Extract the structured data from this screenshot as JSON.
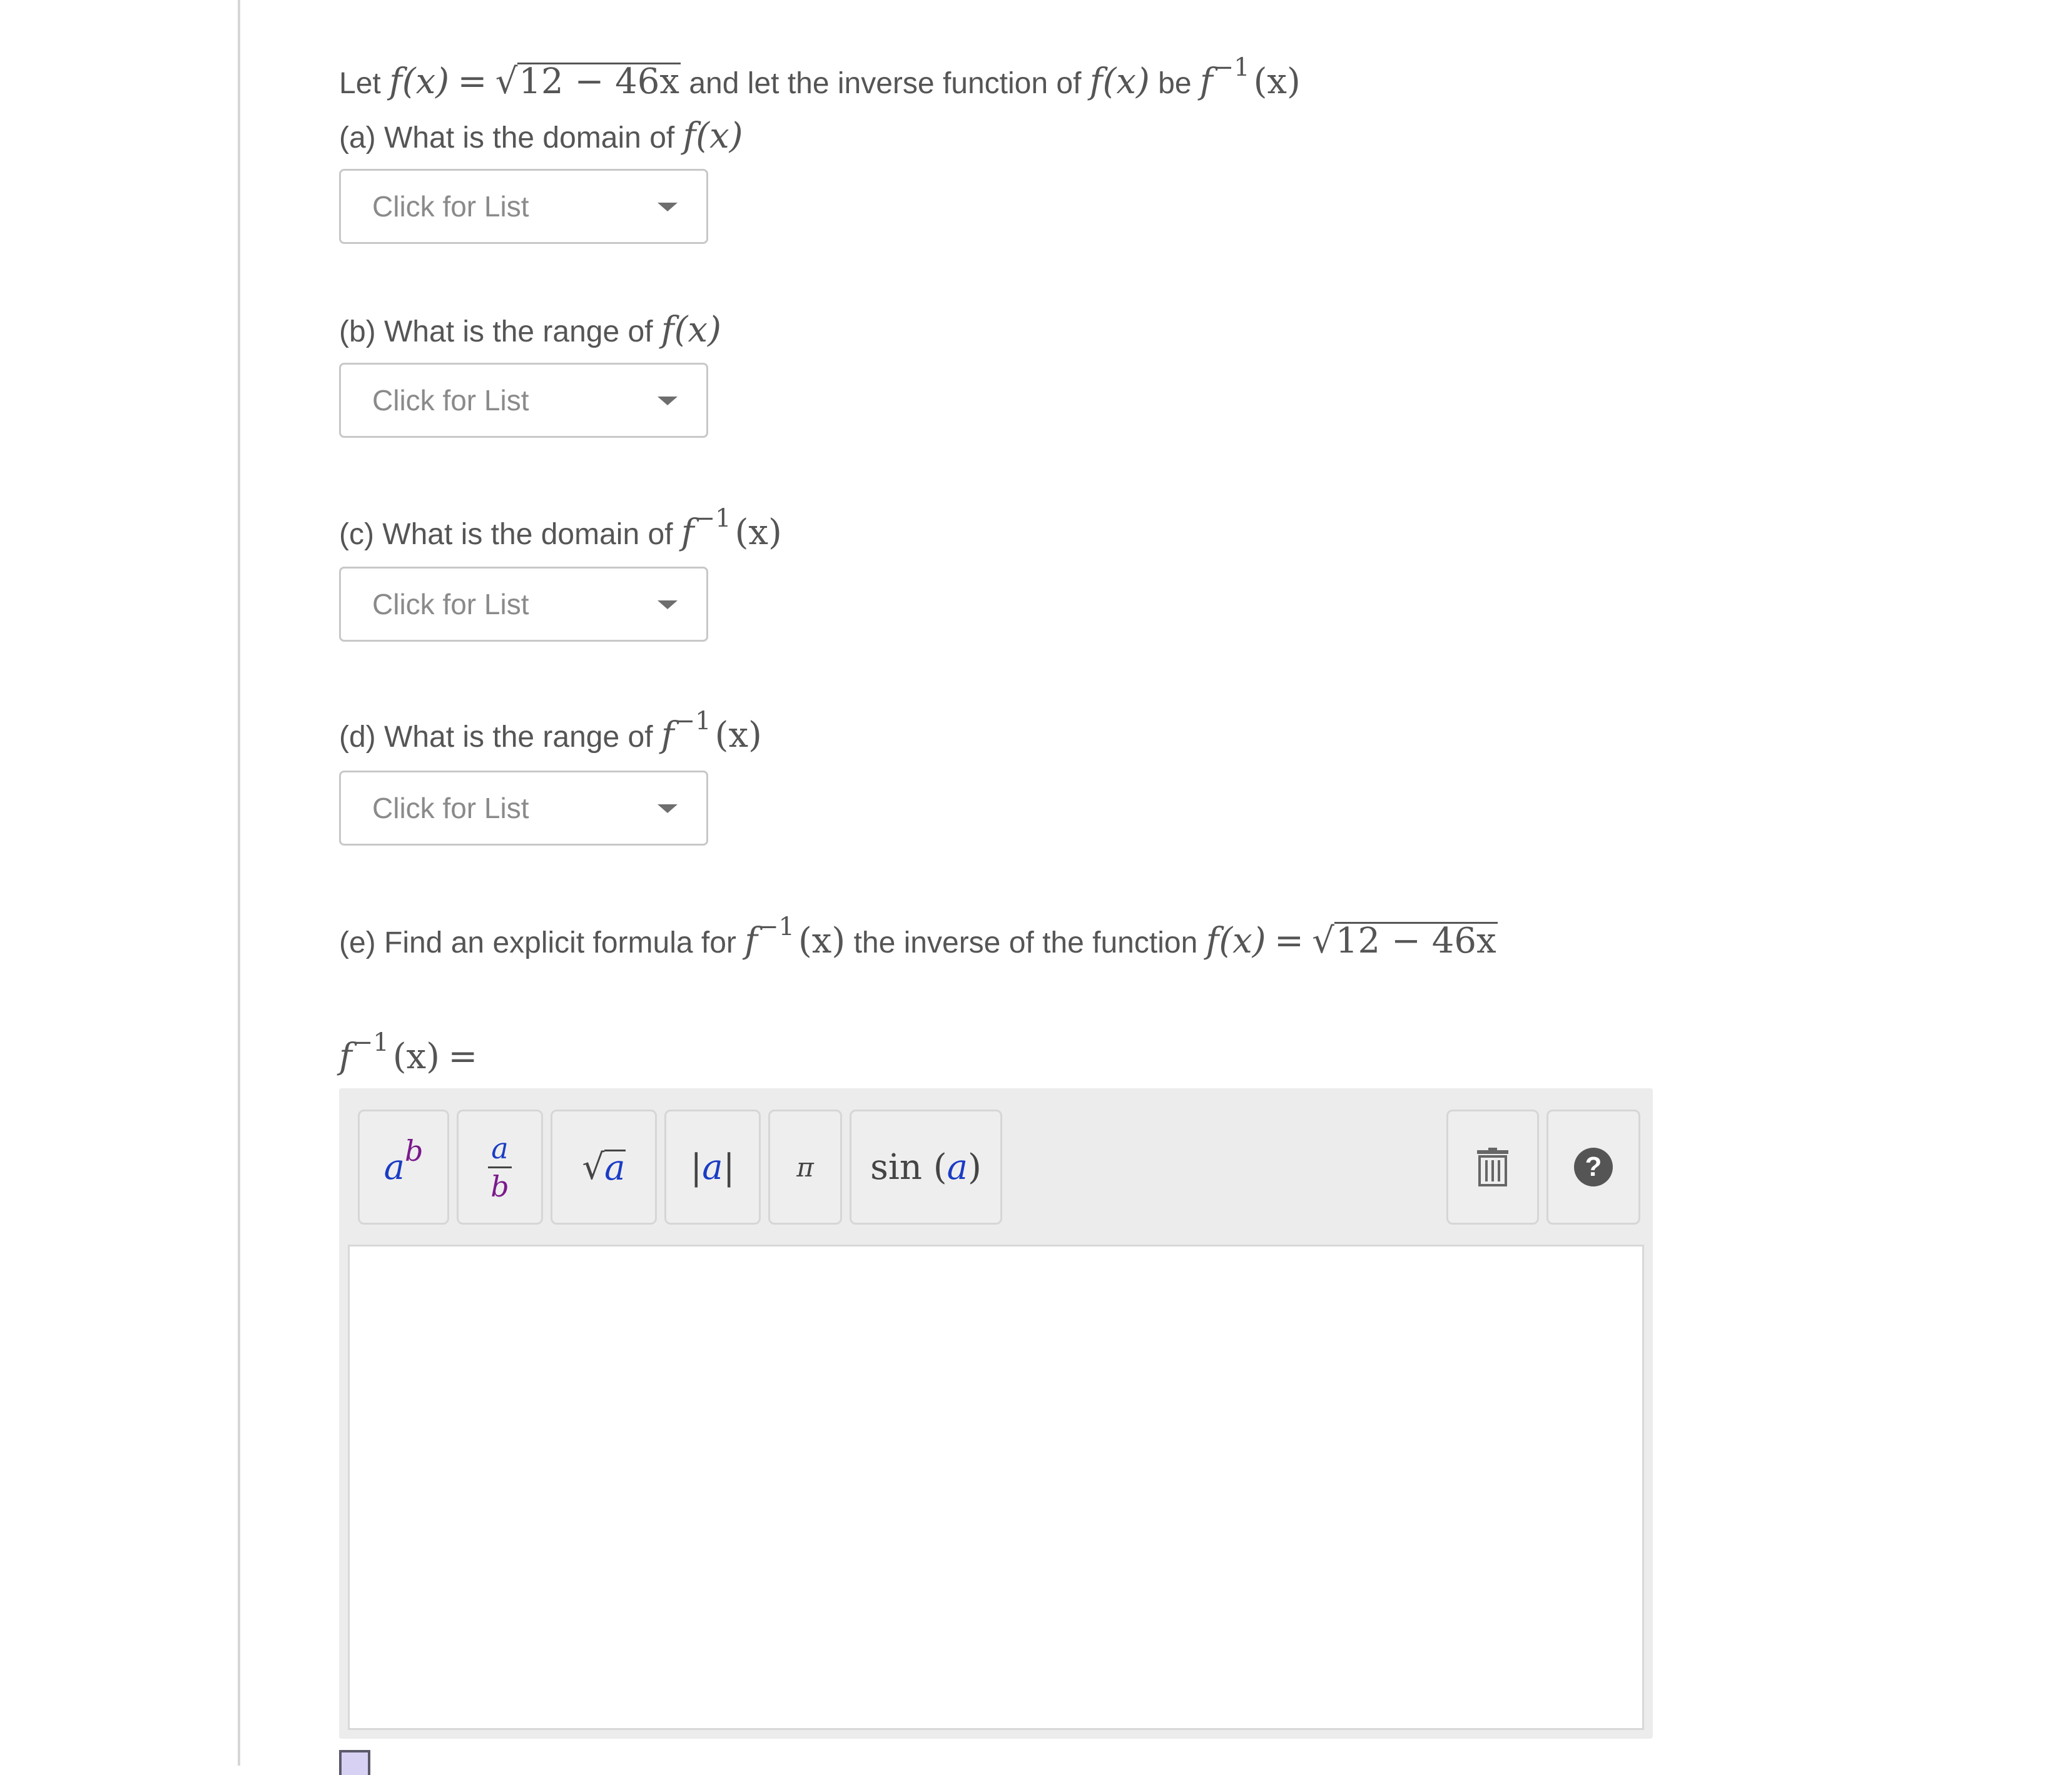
{
  "intro": {
    "t1": "Let",
    "f_x": "f(x)",
    "eq": "=",
    "sqrt": "√",
    "radicand": "12 − 46x",
    "t2": "and let  the inverse function of",
    "f_x2": "f(x)",
    "t3": "be",
    "finv_f": "f",
    "finv_sup": "−1",
    "finv_x": "(x)"
  },
  "part_a": {
    "label": "(a) What is the domain of",
    "math": "f(x)",
    "dropdown": "Click for List"
  },
  "part_b": {
    "label": "(b) What is the range of",
    "math": "f(x)",
    "dropdown": "Click for List"
  },
  "part_c": {
    "label": "(c) What is the domain of",
    "f": "f",
    "sup": "−1",
    "x": "(x)",
    "dropdown": "Click for List"
  },
  "part_d": {
    "label": "(d) What is the range of",
    "f": "f",
    "sup": "−1",
    "x": "(x)",
    "dropdown": "Click for List"
  },
  "part_e": {
    "label": "(e) Find an explicit formula for",
    "f": "f",
    "sup": "−1",
    "x": "(x)",
    "t2": "the inverse of the function",
    "f_x": "f(x)",
    "eq": "=",
    "sqrt": "√",
    "radicand": "12 − 46x"
  },
  "answer": {
    "f": "f",
    "sup": "−1",
    "x": "(x)",
    "eq": "="
  },
  "toolbar": {
    "power_base": "a",
    "power_exp": "b",
    "frac_num": "a",
    "frac_den": "b",
    "sqrt_sym": "√",
    "sqrt_arg": "a",
    "abs_left": "|",
    "abs_arg": "a",
    "abs_right": "|",
    "pi": "π",
    "sin_fn": "sin",
    "sin_open": "(",
    "sin_arg": "a",
    "sin_close": ")",
    "trash_icon": "trash-icon",
    "help_icon": "help-icon",
    "help_glyph": "?"
  },
  "colors": {
    "text": "#555555",
    "blue": "#1a3cc4",
    "purple": "#7a1a8c",
    "toolbar_bg": "#ececec"
  }
}
